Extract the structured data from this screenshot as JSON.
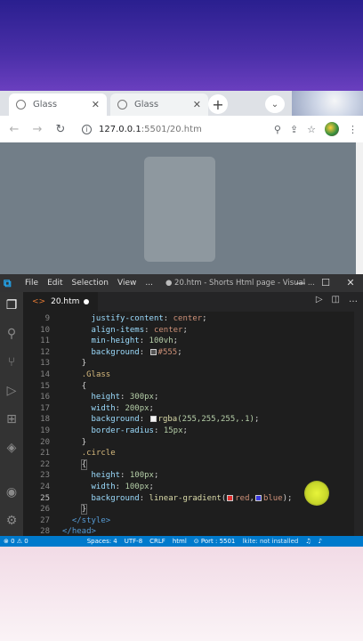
{
  "browser": {
    "tabs": [
      {
        "label": "Glass",
        "active": true
      },
      {
        "label": "Glass",
        "active": false
      }
    ],
    "new_tab": "+",
    "tab_menu": "⌄",
    "url_host": "127.0.0.1",
    "url_rest": ":5501/20.htm"
  },
  "vscode": {
    "menus": [
      "File",
      "Edit",
      "Selection",
      "View"
    ],
    "more_menu": "...",
    "window_title": "● 20.htm - Shorts Html page - Visual ...",
    "tab": {
      "label": "20.htm"
    },
    "lines": [
      {
        "n": "9"
      },
      {
        "n": "10"
      },
      {
        "n": "11"
      },
      {
        "n": "12"
      },
      {
        "n": "13"
      },
      {
        "n": "14"
      },
      {
        "n": "15"
      },
      {
        "n": "16"
      },
      {
        "n": "17"
      },
      {
        "n": "18"
      },
      {
        "n": "19"
      },
      {
        "n": "20"
      },
      {
        "n": "21"
      },
      {
        "n": "22"
      },
      {
        "n": "23"
      },
      {
        "n": "24"
      },
      {
        "n": "25"
      },
      {
        "n": "26"
      },
      {
        "n": "27"
      },
      {
        "n": "28"
      }
    ],
    "code": {
      "l9_p": "justify-content",
      "l9_v": "center",
      "l10_p": "align-items",
      "l10_v": "center",
      "l11_p": "min-height",
      "l11_v": "100vh",
      "l12_p": "background",
      "l12_v": "#555",
      "l13": "}",
      "l14": ".Glass",
      "l15": "{",
      "l16_p": "height",
      "l16_v": "300px",
      "l17_p": "width",
      "l17_v": "200px",
      "l18_p": "background",
      "l18_fn": "rgba",
      "l18_v": "(255,255,255,.1)",
      "l19_p": "border-radius",
      "l19_v": "15px",
      "l20": "}",
      "l21": ".circle",
      "l22": "{",
      "l23_p": "height",
      "l23_v": "100px",
      "l24_p": "width",
      "l24_v": "100px",
      "l25_p": "background",
      "l25_fn": "linear-gradient",
      "l25_a": "red",
      "l25_b": "blue",
      "l26": "}",
      "l27": "</style>",
      "l28": "</head>"
    },
    "status": {
      "errors": "⊗ 0 ⚠ 0",
      "spaces": "Spaces: 4",
      "encoding": "UTF-8",
      "eol": "CRLF",
      "lang": "html",
      "port": "⊙ Port : 5501",
      "lint": "lkite: not installed"
    },
    "colors": {
      "accent": "#007acc",
      "circle": "#e1ef35"
    }
  }
}
